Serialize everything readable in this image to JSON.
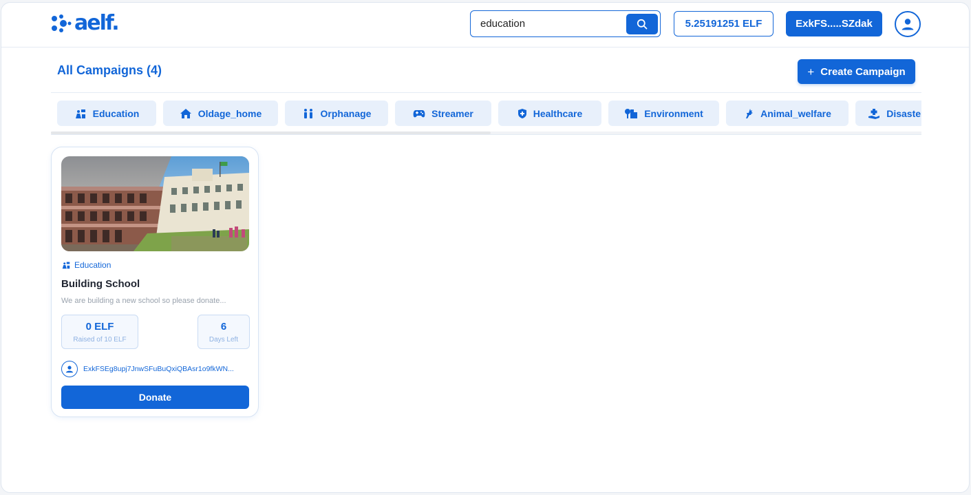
{
  "brand": {
    "logo_text": "aelf."
  },
  "search": {
    "value": "education",
    "placeholder": ""
  },
  "header": {
    "balance": "5.25191251 ELF",
    "wallet": "ExkFS.....SZdak"
  },
  "page": {
    "title": "All Campaigns (4)",
    "create_label": "Create Campaign"
  },
  "categories": [
    {
      "label": "Education",
      "icon": "education-icon"
    },
    {
      "label": "Oldage_home",
      "icon": "home-icon"
    },
    {
      "label": "Orphanage",
      "icon": "children-icon"
    },
    {
      "label": "Streamer",
      "icon": "gamepad-icon"
    },
    {
      "label": "Healthcare",
      "icon": "shield-icon"
    },
    {
      "label": "Environment",
      "icon": "tree-city-icon"
    },
    {
      "label": "Animal_welfare",
      "icon": "deer-icon"
    },
    {
      "label": "Disaster_relief",
      "icon": "hand-aid-icon"
    }
  ],
  "campaign": {
    "category": "Education",
    "title": "Building School",
    "description": "We are building a new school so please donate...",
    "raised_value": "0 ELF",
    "raised_label": "Raised of 10 ELF",
    "days_value": "6",
    "days_label": "Days Left",
    "creator": "ExkFSEg8upj7JnwSFuBuQxiQBAsr1o9fkWN...",
    "donate_label": "Donate"
  },
  "colors": {
    "primary": "#1266d8",
    "chip_bg": "#e8f0fb",
    "muted": "#9aa3ae"
  }
}
